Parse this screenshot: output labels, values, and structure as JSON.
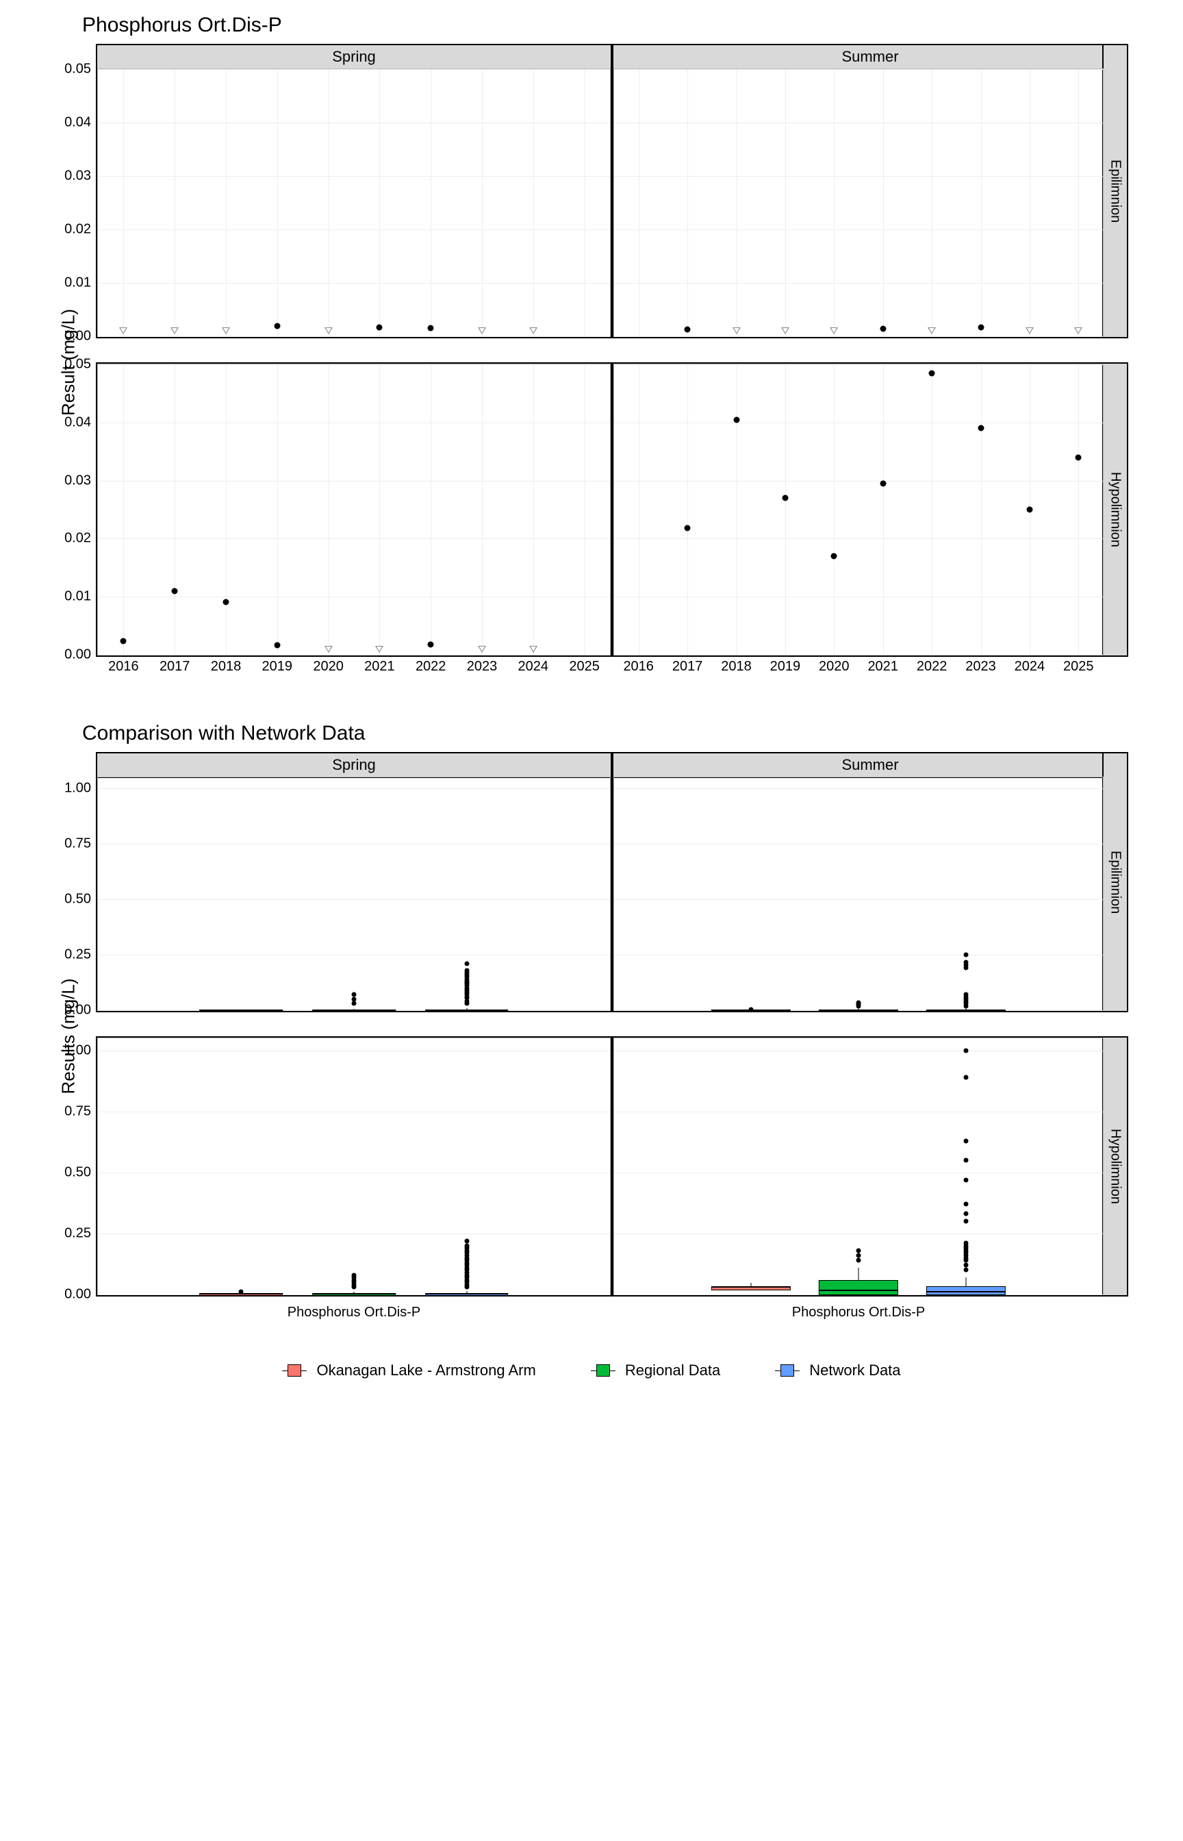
{
  "chart_data": [
    {
      "type": "scatter",
      "title": "Phosphorus Ort.Dis-P",
      "ylabel": "Result (mg/L)",
      "ylim": [
        0,
        0.05
      ],
      "y_ticks": [
        0.0,
        0.01,
        0.02,
        0.03,
        0.04,
        0.05
      ],
      "x_ticks": [
        2016,
        2017,
        2018,
        2019,
        2020,
        2021,
        2022,
        2023,
        2024,
        2025
      ],
      "col_facets": [
        "Spring",
        "Summer"
      ],
      "row_facets": [
        "Epilimnion",
        "Hypolimnion"
      ],
      "series": [
        {
          "name": "detected",
          "marker": "point",
          "facet": "Spring-Epilimnion",
          "points": [
            {
              "x": 2019,
              "y": 0.0019
            },
            {
              "x": 2021,
              "y": 0.0017
            },
            {
              "x": 2022,
              "y": 0.0016
            }
          ]
        },
        {
          "name": "nondetect",
          "marker": "triangle",
          "facet": "Spring-Epilimnion",
          "points": [
            {
              "x": 2016,
              "y": 0.001
            },
            {
              "x": 2017,
              "y": 0.001
            },
            {
              "x": 2018,
              "y": 0.001
            },
            {
              "x": 2020,
              "y": 0.001
            },
            {
              "x": 2023,
              "y": 0.001
            },
            {
              "x": 2024,
              "y": 0.001
            }
          ]
        },
        {
          "name": "detected",
          "marker": "point",
          "facet": "Summer-Epilimnion",
          "points": [
            {
              "x": 2017,
              "y": 0.0013
            },
            {
              "x": 2021,
              "y": 0.0014
            },
            {
              "x": 2023,
              "y": 0.0017
            }
          ]
        },
        {
          "name": "nondetect",
          "marker": "triangle",
          "facet": "Summer-Epilimnion",
          "points": [
            {
              "x": 2018,
              "y": 0.001
            },
            {
              "x": 2019,
              "y": 0.001
            },
            {
              "x": 2020,
              "y": 0.001
            },
            {
              "x": 2022,
              "y": 0.001
            },
            {
              "x": 2024,
              "y": 0.001
            },
            {
              "x": 2025,
              "y": 0.001
            }
          ]
        },
        {
          "name": "detected",
          "marker": "point",
          "facet": "Spring-Hypolimnion",
          "points": [
            {
              "x": 2016,
              "y": 0.0023
            },
            {
              "x": 2017,
              "y": 0.011
            },
            {
              "x": 2018,
              "y": 0.0091
            },
            {
              "x": 2019,
              "y": 0.0016
            },
            {
              "x": 2022,
              "y": 0.0018
            }
          ]
        },
        {
          "name": "nondetect",
          "marker": "triangle",
          "facet": "Spring-Hypolimnion",
          "points": [
            {
              "x": 2020,
              "y": 0.001
            },
            {
              "x": 2021,
              "y": 0.001
            },
            {
              "x": 2023,
              "y": 0.001
            },
            {
              "x": 2024,
              "y": 0.001
            }
          ]
        },
        {
          "name": "detected",
          "marker": "point",
          "facet": "Summer-Hypolimnion",
          "points": [
            {
              "x": 2017,
              "y": 0.0218
            },
            {
              "x": 2018,
              "y": 0.0405
            },
            {
              "x": 2019,
              "y": 0.027
            },
            {
              "x": 2020,
              "y": 0.017
            },
            {
              "x": 2021,
              "y": 0.0295
            },
            {
              "x": 2022,
              "y": 0.0485
            },
            {
              "x": 2023,
              "y": 0.039
            },
            {
              "x": 2024,
              "y": 0.025
            },
            {
              "x": 2025,
              "y": 0.034
            }
          ]
        }
      ]
    },
    {
      "type": "boxplot",
      "title": "Comparison with Network Data",
      "ylabel": "Results (mg/L)",
      "ylim": [
        0,
        1.05
      ],
      "y_ticks": [
        0.0,
        0.25,
        0.5,
        0.75,
        1.0
      ],
      "x_category": "Phosphorus Ort.Dis-P",
      "col_facets": [
        "Spring",
        "Summer"
      ],
      "row_facets": [
        "Epilimnion",
        "Hypolimnion"
      ],
      "groups": [
        "Okanagan Lake - Armstrong Arm",
        "Regional Data",
        "Network Data"
      ],
      "colors": {
        "Okanagan Lake - Armstrong Arm": "#f8766d",
        "Regional Data": "#00ba38",
        "Network Data": "#619cff"
      },
      "boxes": {
        "Spring-Epilimnion": [
          {
            "group": "Okanagan Lake - Armstrong Arm",
            "q1": 0.0,
            "median": 0.001,
            "q3": 0.002,
            "low": 0.0,
            "high": 0.003,
            "outliers": []
          },
          {
            "group": "Regional Data",
            "q1": 0.0,
            "median": 0.001,
            "q3": 0.003,
            "low": 0.0,
            "high": 0.007,
            "outliers": [
              0.03,
              0.05,
              0.07
            ]
          },
          {
            "group": "Network Data",
            "q1": 0.0,
            "median": 0.001,
            "q3": 0.004,
            "low": 0.0,
            "high": 0.01,
            "outliers": [
              0.03,
              0.04,
              0.055,
              0.06,
              0.07,
              0.08,
              0.09,
              0.1,
              0.11,
              0.12,
              0.125,
              0.13,
              0.14,
              0.15,
              0.16,
              0.17,
              0.18,
              0.21
            ]
          }
        ],
        "Summer-Epilimnion": [
          {
            "group": "Okanagan Lake - Armstrong Arm",
            "q1": 0.0,
            "median": 0.001,
            "q3": 0.002,
            "low": 0.0,
            "high": 0.003,
            "outliers": [
              0.002
            ]
          },
          {
            "group": "Regional Data",
            "q1": 0.0,
            "median": 0.001,
            "q3": 0.003,
            "low": 0.0,
            "high": 0.008,
            "outliers": [
              0.02,
              0.025,
              0.03,
              0.035
            ]
          },
          {
            "group": "Network Data",
            "q1": 0.0,
            "median": 0.001,
            "q3": 0.004,
            "low": 0.0,
            "high": 0.01,
            "outliers": [
              0.02,
              0.03,
              0.04,
              0.05,
              0.06,
              0.07,
              0.19,
              0.205,
              0.215,
              0.25
            ]
          }
        ],
        "Spring-Hypolimnion": [
          {
            "group": "Okanagan Lake - Armstrong Arm",
            "q1": 0.0,
            "median": 0.002,
            "q3": 0.005,
            "low": 0.0,
            "high": 0.008,
            "outliers": [
              0.012
            ]
          },
          {
            "group": "Regional Data",
            "q1": 0.0,
            "median": 0.002,
            "q3": 0.006,
            "low": 0.0,
            "high": 0.012,
            "outliers": [
              0.03,
              0.04,
              0.05,
              0.06,
              0.07,
              0.08
            ]
          },
          {
            "group": "Network Data",
            "q1": 0.0,
            "median": 0.002,
            "q3": 0.006,
            "low": 0.0,
            "high": 0.015,
            "outliers": [
              0.03,
              0.04,
              0.05,
              0.06,
              0.07,
              0.08,
              0.09,
              0.1,
              0.11,
              0.12,
              0.13,
              0.14,
              0.15,
              0.16,
              0.17,
              0.18,
              0.19,
              0.2,
              0.22
            ]
          }
        ],
        "Summer-Hypolimnion": [
          {
            "group": "Okanagan Lake - Armstrong Arm",
            "q1": 0.022,
            "median": 0.03,
            "q3": 0.034,
            "low": 0.017,
            "high": 0.048,
            "outliers": []
          },
          {
            "group": "Regional Data",
            "q1": 0.004,
            "median": 0.017,
            "q3": 0.06,
            "low": 0.0,
            "high": 0.11,
            "outliers": [
              0.14,
              0.16,
              0.18
            ]
          },
          {
            "group": "Network Data",
            "q1": 0.002,
            "median": 0.01,
            "q3": 0.034,
            "low": 0.0,
            "high": 0.07,
            "outliers": [
              0.1,
              0.12,
              0.14,
              0.15,
              0.16,
              0.17,
              0.18,
              0.19,
              0.2,
              0.21,
              0.3,
              0.33,
              0.37,
              0.47,
              0.55,
              0.63,
              0.89,
              1.0
            ]
          }
        ]
      }
    }
  ],
  "legend": [
    "Okanagan Lake - Armstrong Arm",
    "Regional Data",
    "Network Data"
  ]
}
